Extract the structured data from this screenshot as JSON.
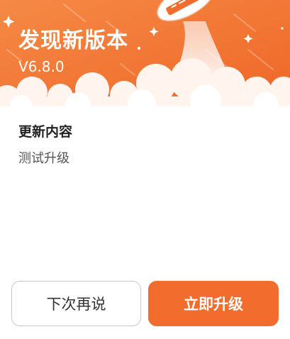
{
  "colors": {
    "accent": "#f26d2d",
    "header_gradient_start": "#f58a45",
    "header_gradient_end": "#ef6627",
    "cloud": "#fff4ee"
  },
  "header": {
    "title": "发现新版本",
    "version": "V6.8.0",
    "illustration": "rocket-icon"
  },
  "content": {
    "section_title": "更新内容",
    "section_body": "测试升级"
  },
  "actions": {
    "later_label": "下次再说",
    "upgrade_label": "立即升级"
  }
}
